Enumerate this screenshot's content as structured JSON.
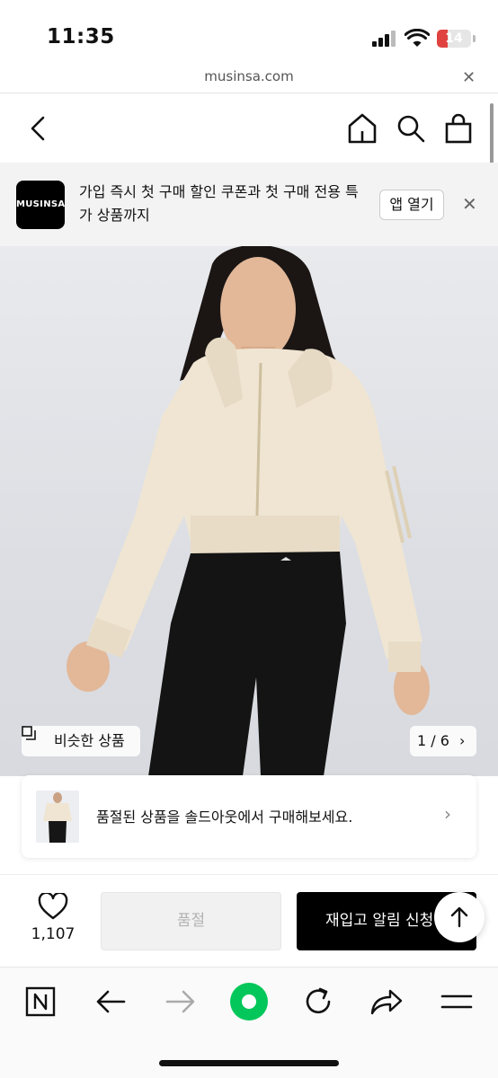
{
  "status_bar": {
    "time": "11:35",
    "battery_level": "14",
    "battery_color": "#e0433f"
  },
  "browser": {
    "url": "musinsa.com",
    "close_icon": "close-icon"
  },
  "header": {
    "icons": [
      "back-arrow-icon",
      "home-icon",
      "search-icon",
      "shopping-bag-icon"
    ]
  },
  "promo": {
    "logo_text": "MUSINSA",
    "message": "가입 즉시 첫 구매 할인 쿠폰과 첫 구매 전용 특가 상품까지",
    "open_app_label": "앱 열기"
  },
  "gallery": {
    "similar_label": "비슷한 상품",
    "current_page": "1 / 6"
  },
  "soldout_card": {
    "message": "품절된 상품을 솔드아웃에서 구매해보세요."
  },
  "purchase": {
    "like_count": "1,107",
    "soldout_label": "품절",
    "restock_label": "재입고 알림 신청"
  },
  "browser_toolbar": {
    "icons": [
      "naver-n-icon",
      "back-icon",
      "forward-icon",
      "green-dot-icon",
      "refresh-icon",
      "share-icon",
      "menu-icon"
    ],
    "accent_color": "#03c75a"
  }
}
